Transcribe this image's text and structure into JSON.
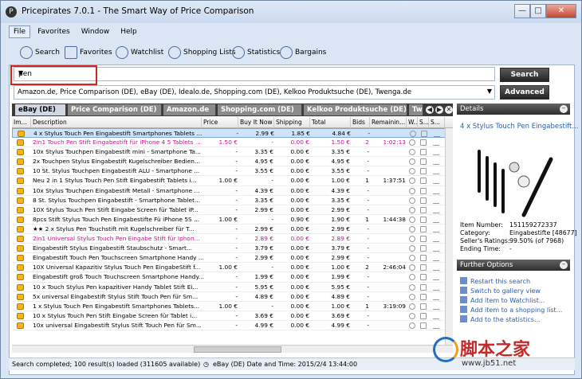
{
  "window": {
    "title": "Pricepirates 7.0.1 - The Smart Way of Price Comparison",
    "min": "—",
    "max": "□",
    "close": "✕"
  },
  "menu": [
    "File",
    "Favorites",
    "Window",
    "Help"
  ],
  "toolbar": [
    "Search",
    "Favorites",
    "Watchlist",
    "Shopping Lists",
    "Statistics",
    "Bargains"
  ],
  "search": {
    "value": "pen",
    "search_btn": "Search",
    "advanced_btn": "Advanced",
    "sources": "Amazon.de, Price Comparison (DE), eBay (DE), Idealo.de, Shopping.com (DE), Kelkoo Produktsuche (DE), Twenga.de",
    "dropdown_icon": "▼"
  },
  "tabs": [
    "eBay (DE)",
    "Price Comparison (DE)",
    "Amazon.de",
    "Shopping.com (DE)",
    "Kelkoo Produktsuche (DE)",
    "Tw"
  ],
  "tab_controls": [
    "◀",
    "▶",
    "✕"
  ],
  "columns": [
    "Im...",
    "Description",
    "Price",
    "Buy It Now",
    "Shipping",
    "Total",
    "Bids",
    "Remainin...",
    "W...",
    "S...",
    "S..."
  ],
  "rows": [
    {
      "d": "4 x Stylus Touch Pen Eingabestift Smartphones Tablets ...",
      "p": "-",
      "b": "2.99 €",
      "s": "1.85 €",
      "t": "4.84 €",
      "bids": "-",
      "rem": "",
      "st": "sel"
    },
    {
      "d": "2in1 Touch Pen Stift Eingabestift für iPhone 4 5 Tablets ...",
      "p": "1.50 €",
      "b": "-",
      "s": "0.00 €",
      "t": "1.50 €",
      "bids": "2",
      "rem": "1:02:13",
      "st": "pink"
    },
    {
      "d": "10x Stylus Touchpen Eingabestift mini - Smartphone Ta...",
      "p": "-",
      "b": "3.35 €",
      "s": "0.00 €",
      "t": "3.35 €",
      "bids": "-",
      "rem": "",
      "st": ""
    },
    {
      "d": "2x Touchpen Stylus Eingabestift Kugelschreiber Bedien...",
      "p": "-",
      "b": "4.95 €",
      "s": "0.00 €",
      "t": "4.95 €",
      "bids": "-",
      "rem": "",
      "st": ""
    },
    {
      "d": "10 St. Stylus Touchpen Eingabestift ALU - Smartphone ...",
      "p": "-",
      "b": "3.55 €",
      "s": "0.00 €",
      "t": "3.55 €",
      "bids": "-",
      "rem": "",
      "st": ""
    },
    {
      "d": "Neu 2 in 1 Stylus Touch Pen Stift Eingabestift Tablets i...",
      "p": "1.00 €",
      "b": "-",
      "s": "0.00 €",
      "t": "1.00 €",
      "bids": "1",
      "rem": "1:37:51",
      "st": ""
    },
    {
      "d": "10x Stylus Touchpen Eingabestift Metall - Smartphone ...",
      "p": "-",
      "b": "4.39 €",
      "s": "0.00 €",
      "t": "4.39 €",
      "bids": "-",
      "rem": "",
      "st": ""
    },
    {
      "d": "8 St. Stylus Touchpen Eingabestift - Smartphone Tablet...",
      "p": "-",
      "b": "3.35 €",
      "s": "0.00 €",
      "t": "3.35 €",
      "bids": "-",
      "rem": "",
      "st": ""
    },
    {
      "d": "10X Stylus Touch Pen Stift Eingabe Screen für Tablet iP...",
      "p": "-",
      "b": "2.99 €",
      "s": "0.00 €",
      "t": "2.99 €",
      "bids": "-",
      "rem": "",
      "st": ""
    },
    {
      "d": "8pcs Stift Stylus Touch Pen Eingabestifte Fü iPhone 5S ...",
      "p": "1.00 €",
      "b": "-",
      "s": "0.90 €",
      "t": "1.90 €",
      "bids": "1",
      "rem": "1:44:38",
      "st": ""
    },
    {
      "d": "★★ 2 x Stylus Pen Touchstift mit Kugelschreiber für T...",
      "p": "-",
      "b": "2.99 €",
      "s": "0.00 €",
      "t": "2.99 €",
      "bids": "-",
      "rem": "",
      "st": ""
    },
    {
      "d": "2in1 Universal Stylus Touch Pen Eingabe Stift für Iphon...",
      "p": "-",
      "b": "2.89 €",
      "s": "0.00 €",
      "t": "2.89 €",
      "bids": "-",
      "rem": "",
      "st": "pink"
    },
    {
      "d": "Eingabestift Stylus Eingabestift Staubschutz - Smart...",
      "p": "-",
      "b": "3.79 €",
      "s": "0.00 €",
      "t": "3.79 €",
      "bids": "-",
      "rem": "",
      "st": ""
    },
    {
      "d": "Eingabestift Touch Pen Touchscreen Smartphone Handy ...",
      "p": "-",
      "b": "2.99 €",
      "s": "0.00 €",
      "t": "2.99 €",
      "bids": "-",
      "rem": "",
      "st": ""
    },
    {
      "d": "10X Universal Kapazitiv Stylus Touch Pen EingabeStift f...",
      "p": "1.00 €",
      "b": "-",
      "s": "0.00 €",
      "t": "1.00 €",
      "bids": "2",
      "rem": "2:46:04",
      "st": ""
    },
    {
      "d": "Eingabestift groß Touch Touchscreen Smartphone Handy...",
      "p": "-",
      "b": "1.99 €",
      "s": "0.00 €",
      "t": "1.99 €",
      "bids": "-",
      "rem": "",
      "st": ""
    },
    {
      "d": "10 x Touch Stylus Pen kapazitiver Handy Tablet Stift Ei...",
      "p": "-",
      "b": "5.95 €",
      "s": "0.00 €",
      "t": "5.95 €",
      "bids": "-",
      "rem": "",
      "st": ""
    },
    {
      "d": "5x universal Eingabestift Stylus Stift Touch Pen für Sm...",
      "p": "-",
      "b": "4.89 €",
      "s": "0.00 €",
      "t": "4.89 €",
      "bids": "-",
      "rem": "",
      "st": ""
    },
    {
      "d": "1 x Stylus Touch Pen Eingabestift Smartphones Tablets...",
      "p": "1.00 €",
      "b": "-",
      "s": "0.00 €",
      "t": "1.00 €",
      "bids": "1",
      "rem": "3:19:09",
      "st": ""
    },
    {
      "d": "10 x Stylus Touch Pen Stift Eingabe Screen für Tablet i...",
      "p": "-",
      "b": "3.69 €",
      "s": "0.00 €",
      "t": "3.69 €",
      "bids": "-",
      "rem": "",
      "st": ""
    },
    {
      "d": "10x universal Eingabestift Stylus Stift Touch Pen für Sm...",
      "p": "-",
      "b": "4.99 €",
      "s": "0.00 €",
      "t": "4.99 €",
      "bids": "-",
      "rem": "",
      "st": ""
    }
  ],
  "details": {
    "header": "Details",
    "title": "4 x Stylus Touch Pen Eingabestift...",
    "kv": [
      [
        "Item Number:",
        "151159272337"
      ],
      [
        "Category:",
        "Eingabestifte [48677]"
      ],
      [
        "Seller's Ratings:",
        "99.50% (of 7968)"
      ],
      [
        "Ending Time:",
        "-"
      ]
    ]
  },
  "options": {
    "header": "Further Options",
    "items": [
      "Restart this search",
      "Switch to gallery view",
      "Add item to Watchlist...",
      "Add item to a shopping list...",
      "Add to the statistics..."
    ]
  },
  "status": {
    "left": "Search completed; 100 result(s) loaded (311605 available)",
    "mid": "eBay (DE) Date and Time: 2015/2/4 13:44:00"
  },
  "watermark": {
    "big": "脚本之家",
    "url": "www.jb51.net"
  }
}
